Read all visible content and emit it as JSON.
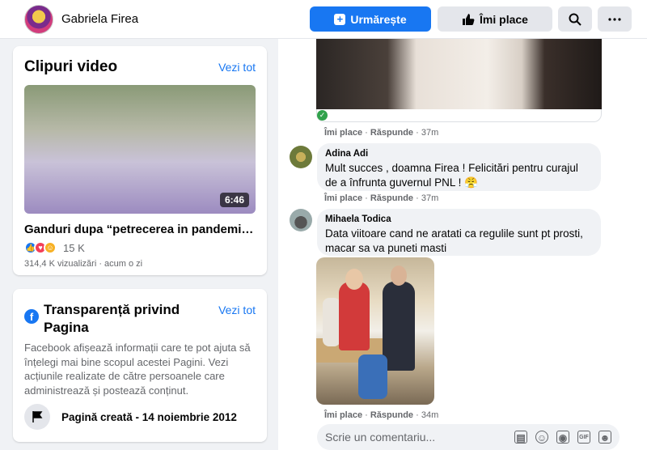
{
  "header": {
    "page_name": "Gabriela Firea",
    "follow_label": "Urmărește",
    "like_label": "Îmi place"
  },
  "videos_card": {
    "title": "Clipuri video",
    "see_all": "Vezi tot",
    "video": {
      "duration": "6:46",
      "title": "Ganduri dupa “petrecerea in pandemie” ...",
      "reaction_count": "15 K",
      "meta": "314,4 K vizualizări · acum o zi"
    }
  },
  "transparency_card": {
    "title": "Transparență privind Pagina",
    "see_all": "Vezi tot",
    "description": "Facebook afișează informații care te pot ajuta să înțelegi mai bine scopul acestei Pagini. Vezi acțiunile realizate de către persoanele care administrează și postează conținut.",
    "created": "Pagină creată - 14 noiembrie 2012"
  },
  "comments": [
    {
      "actions": {
        "like": "Îmi place",
        "reply": "Răspunde",
        "time": "37m"
      }
    },
    {
      "author": "Adina Adi",
      "text": "Mult succes , doamna Firea ! Felicitări pentru curajul de a înfrunta guvernul PNL ! 😤",
      "actions": {
        "like": "Îmi place",
        "reply": "Răspunde",
        "time": "37m"
      }
    },
    {
      "author": "Mihaela Todica",
      "text": "Data viitoare cand ne aratati ca regulile sunt pt prosti, macar sa va puneti masti",
      "actions": {
        "like": "Îmi place",
        "reply": "Răspunde",
        "time": "34m"
      }
    }
  ],
  "composer": {
    "placeholder": "Scrie un comentariu..."
  }
}
